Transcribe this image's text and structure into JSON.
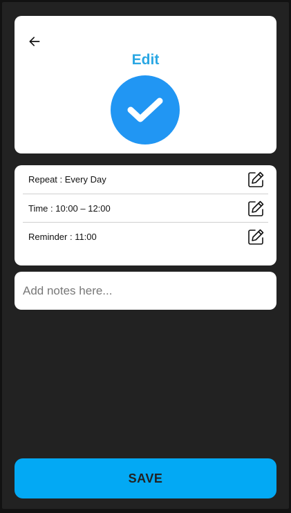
{
  "header": {
    "title": "Edit",
    "back_icon": "arrow-left-icon",
    "status_icon": "checkmark-icon",
    "accent_color": "#2aa7e3",
    "status_color": "#2196f3"
  },
  "settings": {
    "items": [
      {
        "label": "Repeat : Every Day",
        "icon": "edit-icon"
      },
      {
        "label": "Time : 10:00 – 12:00",
        "icon": "edit-icon"
      },
      {
        "label": "Reminder : 11:00",
        "icon": "edit-icon"
      }
    ]
  },
  "notes": {
    "placeholder": "Add notes here...",
    "value": ""
  },
  "footer": {
    "save_label": "SAVE",
    "save_color": "#03a9f4"
  },
  "theme": {
    "background": "#222222",
    "card": "#ffffff"
  }
}
